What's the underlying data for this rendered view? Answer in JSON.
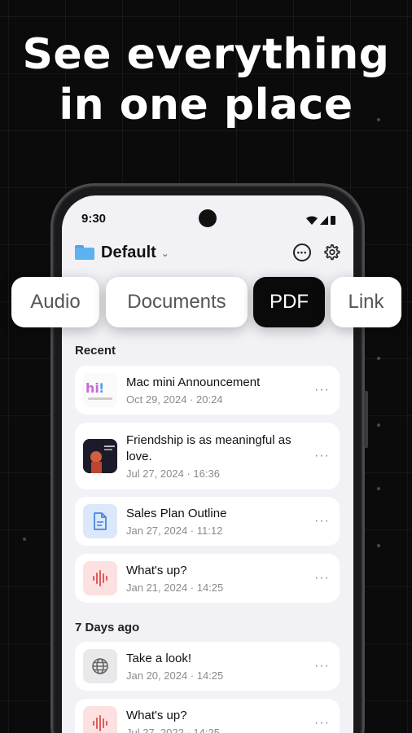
{
  "headline": {
    "line1": "See everything",
    "line2": "in one place"
  },
  "status_bar": {
    "time": "9:30"
  },
  "header": {
    "folder_name": "Default"
  },
  "tabs": [
    {
      "label": "Audio",
      "active": false
    },
    {
      "label": "Documents",
      "active": false
    },
    {
      "label": "PDF",
      "active": true
    },
    {
      "label": "Link",
      "active": false
    }
  ],
  "sections": [
    {
      "label": "Recent",
      "items": [
        {
          "title": "Mac mini Announcement",
          "date": "Oct 29, 2024 · 20:24",
          "thumb": "image"
        },
        {
          "title": "Friendship is as meaningful as love.",
          "date": "Jul 27, 2024 · 16:36",
          "thumb": "video"
        },
        {
          "title": "Sales Plan Outline",
          "date": "Jan 27, 2024 · 11:12",
          "thumb": "document-icon"
        },
        {
          "title": "What's up?",
          "date": "Jan 21, 2024 · 14:25",
          "thumb": "audio-wave-icon"
        }
      ]
    },
    {
      "label": "7 Days ago",
      "items": [
        {
          "title": "Take a look!",
          "date": "Jan 20, 2024 · 14:25",
          "thumb": "globe-icon"
        },
        {
          "title": "What's up?",
          "date": "Jul 27, 2022 · 14:25",
          "thumb": "audio-wave-icon"
        }
      ]
    }
  ],
  "more_glyph": "···",
  "colors": {
    "background": "#0b0b0b",
    "screen": "#f2f2f6",
    "active_tab": "#0a0a0a",
    "doc_thumb": "#dbe8fb",
    "audio_thumb": "#fde0e0",
    "audio_wave": "#e05a5a"
  }
}
